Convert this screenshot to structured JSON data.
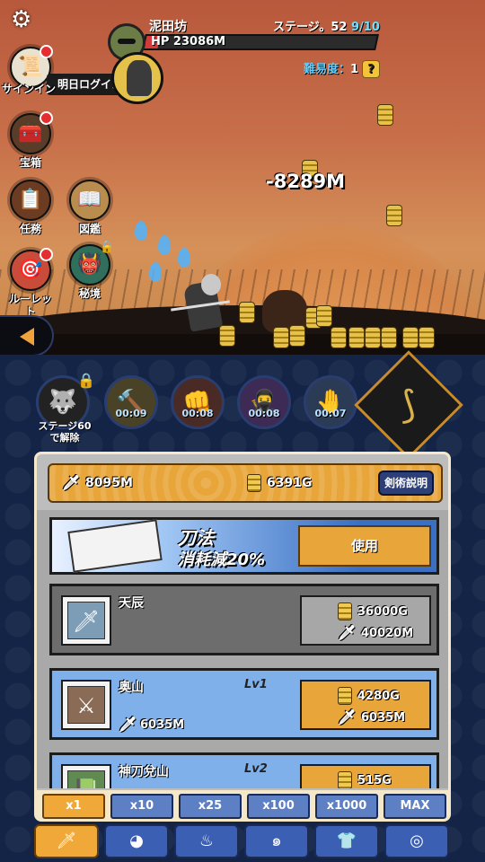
{
  "hud": {
    "boss_name": "泥田坊",
    "stage_label": "ステージ。52",
    "stage_progress": "9/10",
    "hp_text": "HP 23086M",
    "hp_fraction": 0.06,
    "difficulty_label": "難易度：",
    "difficulty_value": "1",
    "help_glyph": "?"
  },
  "sidebar": {
    "signin_label": "サインイン",
    "signin_banner": "明日ログイン",
    "chest_label": "宝箱",
    "mission_label": "任務",
    "encyclopedia_label": "図鑑",
    "roulette_label": "ルーレット",
    "secret_label": "秘境"
  },
  "battle": {
    "damage_text": "-8289M"
  },
  "skills": {
    "locked_text": "ステージ60 で解除",
    "timers": [
      "00:09",
      "00:08",
      "00:08",
      "00:07"
    ]
  },
  "resources": {
    "blade_value": "8095M",
    "gold_value": "6391G",
    "explain_label": "剣術説明"
  },
  "promo": {
    "title": "刀法",
    "subtitle": "消耗減20%",
    "button_label": "使用"
  },
  "items": [
    {
      "name": "天辰",
      "level": "",
      "power": "",
      "gold_cost": "36000G",
      "blade_cost": "40020M"
    },
    {
      "name": "奥山",
      "level": "Lv1",
      "power": "6035M",
      "gold_cost": "4280G",
      "blade_cost": "6035M"
    },
    {
      "name": "神刀兌山",
      "level": "Lv2",
      "power": "",
      "gold_cost": "515G",
      "blade_cost": ""
    }
  ],
  "multipliers": [
    "x1",
    "x10",
    "x25",
    "x100",
    "x1000",
    "MAX"
  ],
  "colors": {
    "accent_orange": "#f0a838",
    "panel_blue": "#142447",
    "hp_red": "#d53a3a"
  }
}
